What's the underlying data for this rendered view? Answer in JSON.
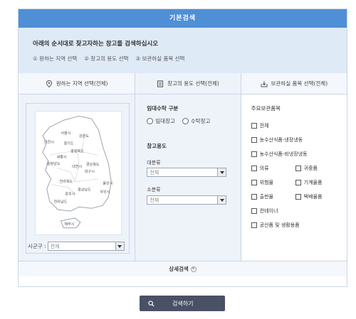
{
  "title": "기본검색",
  "guide": {
    "title": "아래의 순서대로 찾고자하는 창고를 검색하십시오",
    "steps": [
      "① 원하는 지역 선택",
      "② 창고의 용도 선택",
      "③ 보관하실 품목 선택"
    ]
  },
  "columns": {
    "region": "원하는 지역 선택(전체)",
    "usage": "창고의 용도 선택(전체)",
    "items": "보관하실 품목 선택(전체)"
  },
  "map": {
    "cities": [
      "서울시",
      "강원도",
      "인천시",
      "경기도",
      "충청북도",
      "세종시",
      "충청남도",
      "대전시",
      "경상북도",
      "대구시",
      "전라북도",
      "울산시",
      "경상남도",
      "광주시",
      "부산시",
      "전라남도",
      "제주시"
    ],
    "sigungu_label": "시군구 :",
    "sigungu_value": "전체"
  },
  "usage": {
    "contract_label": "임대수탁 구분",
    "radio1": "임대창고",
    "radio2": "수탁창고",
    "purpose_label": "창고용도",
    "major_label": "대분류",
    "major_value": "전체",
    "minor_label": "소분류",
    "minor_value": "전체"
  },
  "items": {
    "title": "주요보관품목",
    "all": "전체",
    "agri_cold": "농수산식품-냉장냉동",
    "agri_noncold": "농수산식품-비냉장냉동",
    "clothing": "의류",
    "valuables": "귀중품",
    "hazardous": "위험물",
    "machinery": "기계물품",
    "publications": "출판물",
    "parcel": "택배물품",
    "container": "컨테이너",
    "industrial": "공산품 및 생활용품"
  },
  "detail_search": "상세검색",
  "search_button": "검색하기",
  "colors": {
    "header": "#4f8fd6",
    "guide_bg": "#dfeaf7",
    "button": "#4a5065"
  }
}
